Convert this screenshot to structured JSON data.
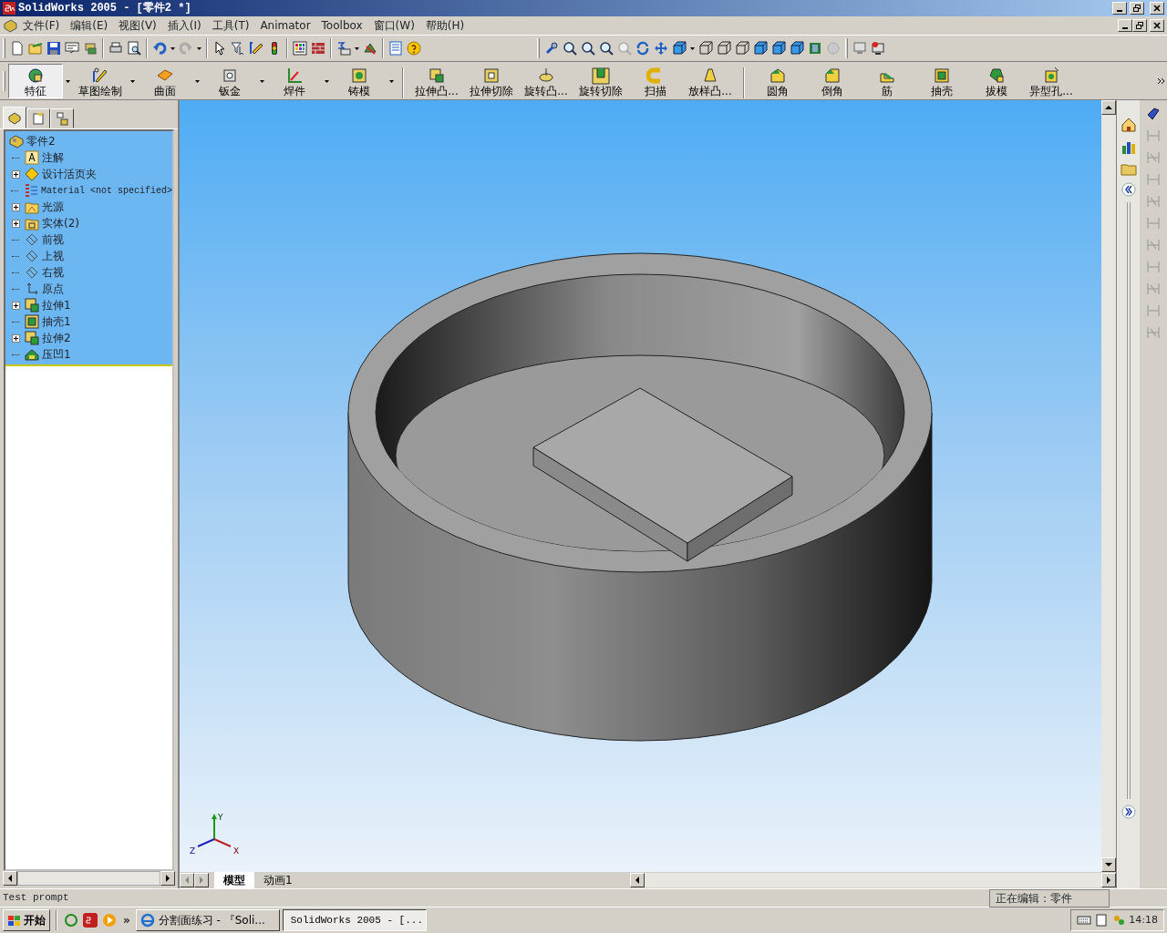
{
  "window": {
    "title": "SolidWorks 2005 - [零件2 *]"
  },
  "menu": [
    {
      "label": "文件(F)"
    },
    {
      "label": "编辑(E)"
    },
    {
      "label": "视图(V)"
    },
    {
      "label": "插入(I)"
    },
    {
      "label": "工具(T)"
    },
    {
      "label": "Animator"
    },
    {
      "label": "Toolbox"
    },
    {
      "label": "窗口(W)"
    },
    {
      "label": "帮助(H)"
    }
  ],
  "feature_toolbar": [
    {
      "label": "特征",
      "kind": "feature",
      "dropdown": true,
      "selected": true
    },
    {
      "label": "草图绘制",
      "kind": "sketch",
      "dropdown": true,
      "selected": false
    },
    {
      "label": "曲面",
      "kind": "surface",
      "dropdown": true,
      "selected": false
    },
    {
      "label": "钣金",
      "kind": "sheetmetal",
      "dropdown": true,
      "selected": false
    },
    {
      "label": "焊件",
      "kind": "weldment",
      "dropdown": true,
      "selected": false
    },
    {
      "label": "铸模",
      "kind": "mold",
      "dropdown": true,
      "selected": false
    },
    {
      "label": "拉伸凸...",
      "kind": "extrude",
      "dropdown": false,
      "selected": false
    },
    {
      "label": "拉伸切除",
      "kind": "cut",
      "dropdown": false,
      "selected": false
    },
    {
      "label": "旋转凸...",
      "kind": "revolve",
      "dropdown": false,
      "selected": false
    },
    {
      "label": "旋转切除",
      "kind": "revcut",
      "dropdown": false,
      "selected": false
    },
    {
      "label": "扫描",
      "kind": "sweep",
      "dropdown": false,
      "selected": false
    },
    {
      "label": "放样凸...",
      "kind": "loft",
      "dropdown": false,
      "selected": false
    },
    {
      "label": "圆角",
      "kind": "fillet",
      "dropdown": false,
      "selected": false
    },
    {
      "label": "倒角",
      "kind": "chamfer",
      "dropdown": false,
      "selected": false
    },
    {
      "label": "筋",
      "kind": "rib",
      "dropdown": false,
      "selected": false
    },
    {
      "label": "抽壳",
      "kind": "shell",
      "dropdown": false,
      "selected": false
    },
    {
      "label": "拔模",
      "kind": "draft",
      "dropdown": false,
      "selected": false
    },
    {
      "label": "异型孔...",
      "kind": "hole",
      "dropdown": false,
      "selected": false
    }
  ],
  "panel_tabs": [
    {
      "kind": "tree",
      "selected": true
    },
    {
      "kind": "property",
      "selected": false
    },
    {
      "kind": "config",
      "selected": false
    }
  ],
  "feature_tree": {
    "label": "零件2",
    "kind": "part",
    "children": [
      {
        "label": "注解",
        "kind": "annotation",
        "expandable": false
      },
      {
        "label": "设计活页夹",
        "kind": "binder",
        "expandable": true
      },
      {
        "label": "Material <not specified>",
        "kind": "material",
        "expandable": false
      },
      {
        "label": "光源",
        "kind": "lights",
        "expandable": true
      },
      {
        "label": "实体(2)",
        "kind": "bodies",
        "expandable": true
      },
      {
        "label": "前视",
        "kind": "plane",
        "expandable": false
      },
      {
        "label": "上视",
        "kind": "plane",
        "expandable": false
      },
      {
        "label": "右视",
        "kind": "plane",
        "expandable": false
      },
      {
        "label": "原点",
        "kind": "origin",
        "expandable": false
      },
      {
        "label": "拉伸1",
        "kind": "extrude",
        "expandable": true
      },
      {
        "label": "抽壳1",
        "kind": "shell",
        "expandable": false
      },
      {
        "label": "拉伸2",
        "kind": "extrude",
        "expandable": true
      },
      {
        "label": "压凹1",
        "kind": "indent",
        "expandable": false
      }
    ]
  },
  "axis_triad": {
    "x": "X",
    "y": "Y",
    "z": "Z"
  },
  "view_tabs": [
    {
      "label": "模型",
      "selected": true
    },
    {
      "label": "动画1",
      "selected": false
    }
  ],
  "status_bar": {
    "prompt": "Test prompt",
    "state": "正在编辑：零件"
  },
  "taskbar": {
    "start": "开始",
    "more": "»",
    "tasks": [
      {
        "label": "分割面练习 - 『Soli...",
        "kind": "browser",
        "selected": false
      },
      {
        "label": "SolidWorks 2005 - [...",
        "kind": "solidworks",
        "selected": true
      }
    ],
    "clock": "14:18"
  }
}
